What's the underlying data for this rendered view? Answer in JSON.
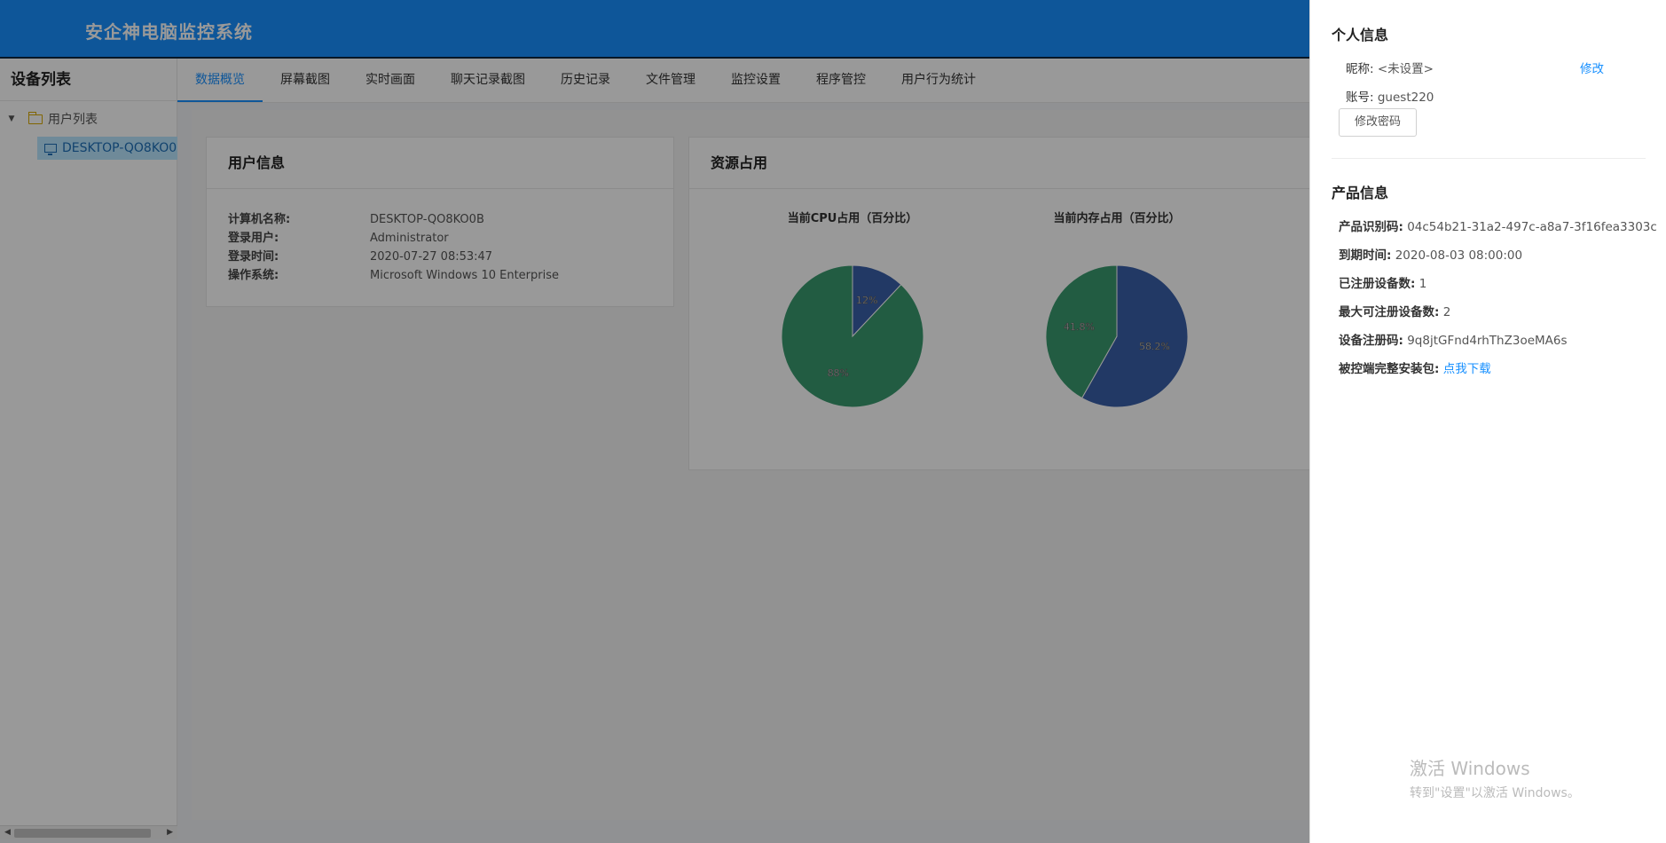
{
  "header": {
    "title": "安企神电脑监控系统"
  },
  "sidebar": {
    "title": "设备列表",
    "tree": {
      "root_label": "用户列表",
      "devices": [
        "DESKTOP-QO8KO0B"
      ]
    }
  },
  "tabs": [
    {
      "label": "数据概览",
      "active": true
    },
    {
      "label": "屏幕截图"
    },
    {
      "label": "实时画面"
    },
    {
      "label": "聊天记录截图"
    },
    {
      "label": "历史记录"
    },
    {
      "label": "文件管理"
    },
    {
      "label": "监控设置"
    },
    {
      "label": "程序管控"
    },
    {
      "label": "用户行为统计"
    }
  ],
  "user_card": {
    "title": "用户信息",
    "rows": [
      {
        "key": "计算机名称:",
        "value": "DESKTOP-QO8KO0B"
      },
      {
        "key": "登录用户:",
        "value": "Administrator"
      },
      {
        "key": "登录时间:",
        "value": "2020-07-27 08:53:47"
      },
      {
        "key": "操作系统:",
        "value": "Microsoft Windows 10 Enterprise"
      }
    ]
  },
  "resource_card": {
    "title": "资源占用"
  },
  "chart_data": [
    {
      "type": "pie",
      "title": "当前CPU占用（百分比）",
      "slices": [
        {
          "label": "12%",
          "value": 12,
          "color": "#3a5fa8"
        },
        {
          "label": "88%",
          "value": 88,
          "color": "#3a9a6e"
        }
      ]
    },
    {
      "type": "pie",
      "title": "当前内存占用（百分比）",
      "slices": [
        {
          "label": "58.2%",
          "value": 58.2,
          "color": "#3a5fa8"
        },
        {
          "label": "41.8%",
          "value": 41.8,
          "color": "#3a9a6e"
        }
      ]
    }
  ],
  "drawer": {
    "personal_title": "个人信息",
    "nickname_key": "昵称:",
    "nickname_value": "<未设置>",
    "edit_link": "修改",
    "account_key": "账号:",
    "account_value": "guest220",
    "change_password_button": "修改密码",
    "product_title": "产品信息",
    "product_id_key": "产品识别码:",
    "product_id_value": "04c54b21-31a2-497c-a8a7-3f16fea3303c",
    "expire_key": "到期时间:",
    "expire_value": "2020-08-03 08:00:00",
    "registered_key": "已注册设备数:",
    "registered_value": "1",
    "max_key": "最大可注册设备数:",
    "max_value": "2",
    "reg_code_key": "设备注册码:",
    "reg_code_value": "9q8jtGFnd4rhThZ3oeMA6s",
    "package_key": "被控端完整安装包:",
    "package_link": "点我下载"
  },
  "watermark": {
    "line1": "激活 Windows",
    "line2": "转到\"设置\"以激活 Windows。"
  },
  "colors": {
    "primary": "#1890ff",
    "pie_blue": "#3a5fa8",
    "pie_green": "#3a9a6e"
  }
}
